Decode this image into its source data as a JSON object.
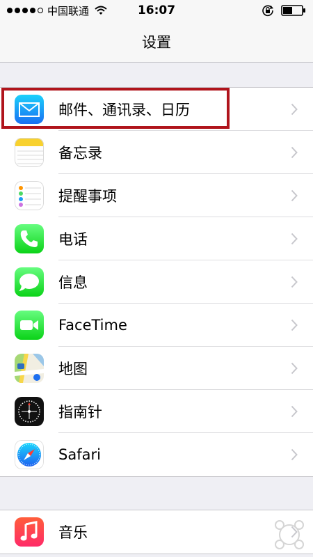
{
  "status_bar": {
    "carrier": "中国联通",
    "time": "16:07",
    "signal_strength": 4,
    "signal_max": 5
  },
  "nav": {
    "title": "设置"
  },
  "groups": [
    {
      "rows": [
        {
          "label": "邮件、通讯录、日历",
          "icon": "mail-icon"
        },
        {
          "label": "备忘录",
          "icon": "notes-icon"
        },
        {
          "label": "提醒事项",
          "icon": "reminders-icon"
        },
        {
          "label": "电话",
          "icon": "phone-icon"
        },
        {
          "label": "信息",
          "icon": "messages-icon"
        },
        {
          "label": "FaceTime",
          "icon": "facetime-icon"
        },
        {
          "label": "地图",
          "icon": "maps-icon"
        },
        {
          "label": "指南针",
          "icon": "compass-icon"
        },
        {
          "label": "Safari",
          "icon": "safari-icon"
        }
      ]
    },
    {
      "rows": [
        {
          "label": "音乐",
          "icon": "music-icon"
        }
      ]
    }
  ],
  "highlight": {
    "target": "邮件、通讯录、日历",
    "color": "#b0141c"
  },
  "colors": {
    "background": "#efeff4",
    "bar": "#f7f7f7",
    "separator": "#c8c7cc",
    "chevron": "#c7c7cc"
  }
}
